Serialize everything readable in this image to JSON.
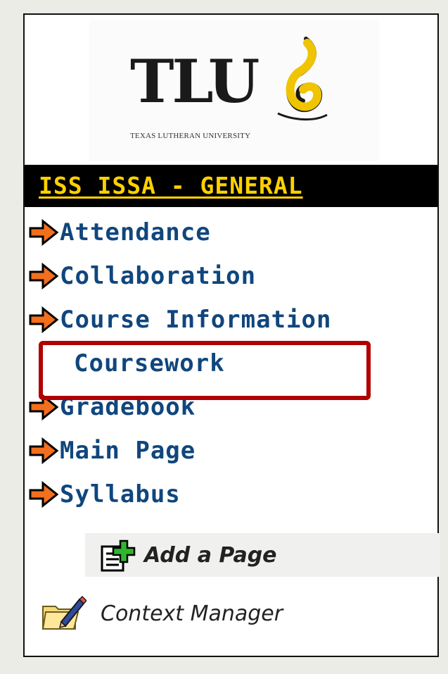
{
  "logo": {
    "wordmark": "TLU",
    "subtitle": "TEXAS LUTHERAN UNIVERSITY"
  },
  "course": {
    "title": "ISS ISSA - GENERAL"
  },
  "nav": {
    "items": [
      {
        "label": "Attendance",
        "icon": "arrow-right-icon",
        "highlighted": false
      },
      {
        "label": "Collaboration",
        "icon": "arrow-right-icon",
        "highlighted": false
      },
      {
        "label": "Course Information",
        "icon": "arrow-right-icon",
        "highlighted": false
      },
      {
        "label": "Coursework",
        "icon": null,
        "highlighted": true
      },
      {
        "label": "Gradebook",
        "icon": "arrow-right-icon",
        "highlighted": false
      },
      {
        "label": "Main Page",
        "icon": "arrow-right-icon",
        "highlighted": false
      },
      {
        "label": "Syllabus",
        "icon": "arrow-right-icon",
        "highlighted": false
      }
    ]
  },
  "actions": {
    "add_page": "Add a Page",
    "context_manager": "Context Manager"
  },
  "colors": {
    "header_bg": "#000000",
    "header_text": "#ffd100",
    "nav_text": "#10467d",
    "arrow": "#f26f1d",
    "highlight_border": "#b00000",
    "page_bg": "#ecece6"
  }
}
